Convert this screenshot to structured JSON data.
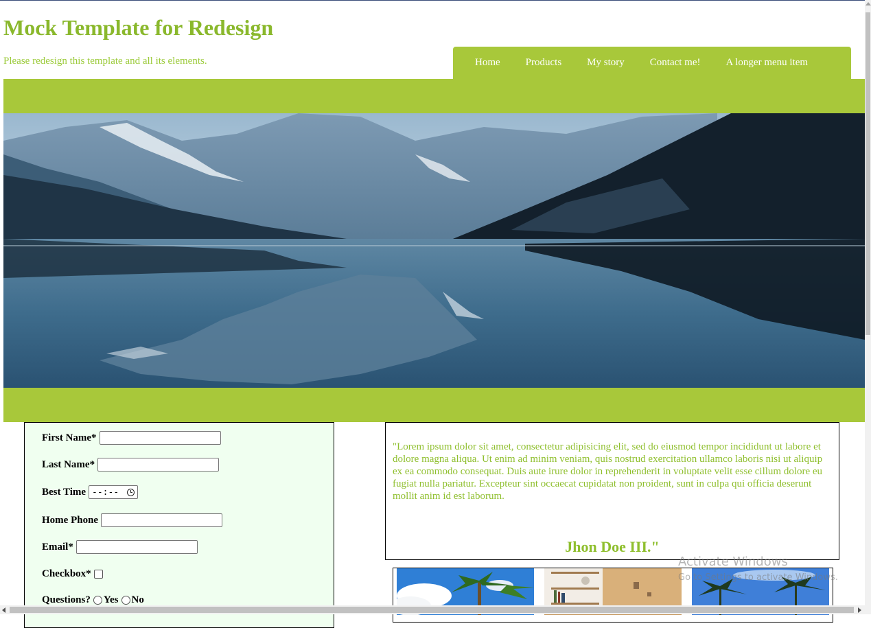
{
  "header": {
    "title": "Mock Template for Redesign",
    "subtitle": "Please redesign this template and all its elements."
  },
  "nav": {
    "items": [
      {
        "label": "Home"
      },
      {
        "label": "Products"
      },
      {
        "label": "My story"
      },
      {
        "label": "Contact me!"
      },
      {
        "label": "A longer menu item"
      }
    ]
  },
  "colors": {
    "brand_green": "#a8c83a",
    "title_green": "#8ab82c",
    "form_background": "#f0fff0"
  },
  "form": {
    "first_name_label": "First Name*",
    "last_name_label": "Last Name*",
    "best_time_label": "Best Time",
    "best_time_value": "--:--",
    "home_phone_label": "Home Phone",
    "email_label": "Email*",
    "checkbox_label": "Checkbox*",
    "questions_label": "Questions?",
    "yes_label": "Yes",
    "no_label": "No"
  },
  "testimonial": {
    "quote": "\"Lorem ipsum dolor sit amet, consectetur adipisicing elit, sed do eiusmod tempor incididunt ut labore et dolore magna aliqua. Ut enim ad minim veniam, quis nostrud exercitation ullamco laboris nisi ut aliquip ex ea commodo consequat. Duis aute irure dolor in reprehenderit in voluptate velit esse cillum dolore eu fugiat nulla pariatur. Excepteur sint occaecat cupidatat non proident, sunt in culpa qui officia deserunt mollit anim id est laborum.",
    "author": "Jhon Doe III.\""
  },
  "overlay": {
    "activate_title": "Activate Windows",
    "activate_sub": "Go to Settings to activate Windows."
  },
  "icons": [
    "clock-icon",
    "scroll-arrow-left-icon",
    "scroll-arrow-right-icon",
    "scroll-arrow-up-icon"
  ]
}
